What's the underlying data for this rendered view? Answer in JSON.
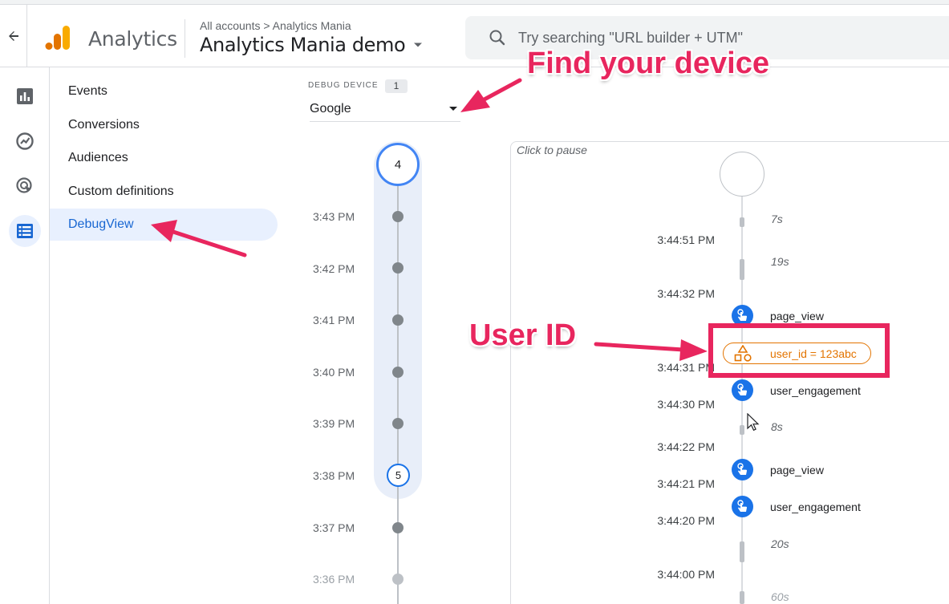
{
  "header": {
    "app_name": "Analytics",
    "breadcrumb": "All accounts > Analytics Mania",
    "property_name": "Analytics Mania demo",
    "search_placeholder": "Try searching \"URL builder + UTM\""
  },
  "rail": {
    "icons": [
      "reports-icon",
      "explore-icon",
      "advertising-icon",
      "configure-icon"
    ],
    "active": "configure-icon"
  },
  "nav": {
    "items": [
      {
        "label": "Events"
      },
      {
        "label": "Conversions"
      },
      {
        "label": "Audiences"
      },
      {
        "label": "Custom definitions"
      },
      {
        "label": "DebugView"
      }
    ],
    "active_index": 4
  },
  "debug_device": {
    "label": "DEBUG DEVICE",
    "count": "1",
    "selected": "Google"
  },
  "minutes": {
    "top_count": "4",
    "times": [
      "3:43 PM",
      "3:42 PM",
      "3:41 PM",
      "3:40 PM",
      "3:39 PM",
      "3:38 PM",
      "3:37 PM",
      "3:36 PM"
    ],
    "badge_count": "5"
  },
  "stream": {
    "pause_label": "Click to pause",
    "times": [
      "3:44:51 PM",
      "3:44:32 PM",
      "3:44:31 PM",
      "3:44:30 PM",
      "3:44:22 PM",
      "3:44:21 PM",
      "3:44:20 PM",
      "3:44:00 PM"
    ],
    "gaps": [
      "7s",
      "19s",
      "8s",
      "20s",
      "60s"
    ],
    "events": [
      "page_view",
      "user_engagement",
      "page_view",
      "user_engagement"
    ],
    "user_property": "user_id = 123abc"
  },
  "annotations": {
    "find_device": "Find your device",
    "user_id": "User ID"
  },
  "colors": {
    "accent": "#1a73e8",
    "annotation": "#e8265e",
    "user_property": "#e37400",
    "nav_active_bg": "#e8f0fe"
  }
}
